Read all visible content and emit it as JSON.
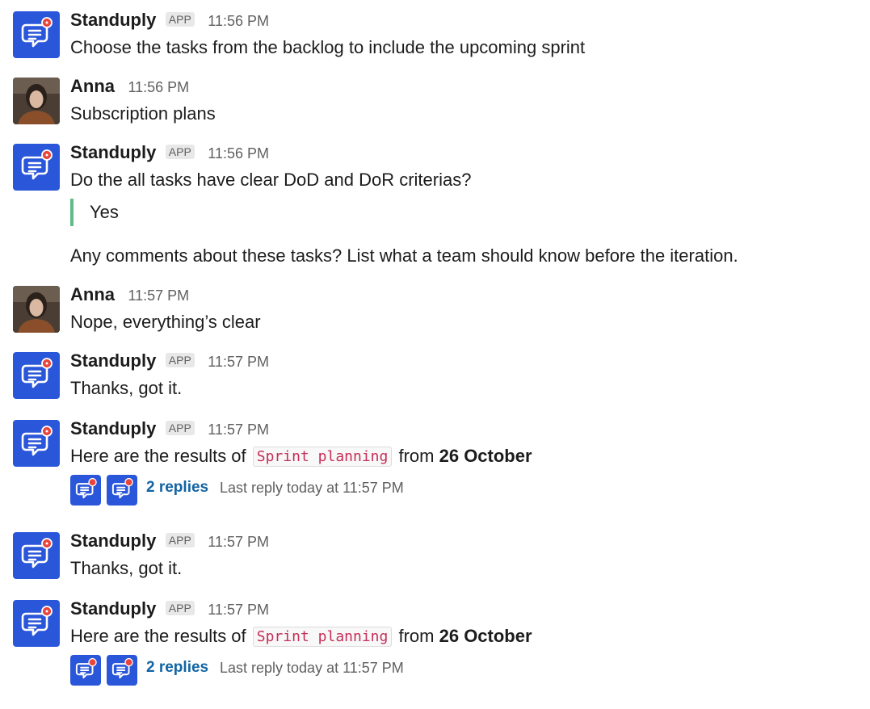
{
  "bot": {
    "name": "Standuply",
    "badge": "APP"
  },
  "user": {
    "name": "Anna"
  },
  "messages": {
    "m1": {
      "time": "11:56 PM",
      "text": "Choose the tasks from the backlog to include the upcoming sprint"
    },
    "m2": {
      "time": "11:56 PM",
      "text": "Subscription plans"
    },
    "m3": {
      "time": "11:56 PM",
      "text": "Do the all tasks have clear DoD and DoR criterias?",
      "quote": "Yes",
      "followup": "Any comments about these tasks? List what a team should know before the iteration."
    },
    "m4": {
      "time": "11:57 PM",
      "text": "Nope, everything’s clear"
    },
    "m5": {
      "time": "11:57 PM",
      "text": "Thanks, got it."
    },
    "m6": {
      "time": "11:57 PM",
      "prefix": "Here are the results of",
      "code": "Sprint planning",
      "mid": "from",
      "date": "26 October",
      "replies": "2 replies",
      "last_reply": "Last reply today at 11:57 PM"
    },
    "m7": {
      "time": "11:57 PM",
      "text": "Thanks, got it."
    },
    "m8": {
      "time": "11:57 PM",
      "prefix": "Here are the results of",
      "code": "Sprint planning",
      "mid": "from",
      "date": "26 October",
      "replies": "2 replies",
      "last_reply": "Last reply today at 11:57 PM"
    }
  },
  "colors": {
    "bot_avatar": "#2a56d9",
    "notification_dot": "#e8453c",
    "quote_bar": "#5fbc88",
    "link": "#1264a3",
    "code_text": "#c62e58"
  },
  "icons": {
    "bot_avatar": "standuply-chat-bubble-icon",
    "user_avatar": "anna-photo"
  }
}
